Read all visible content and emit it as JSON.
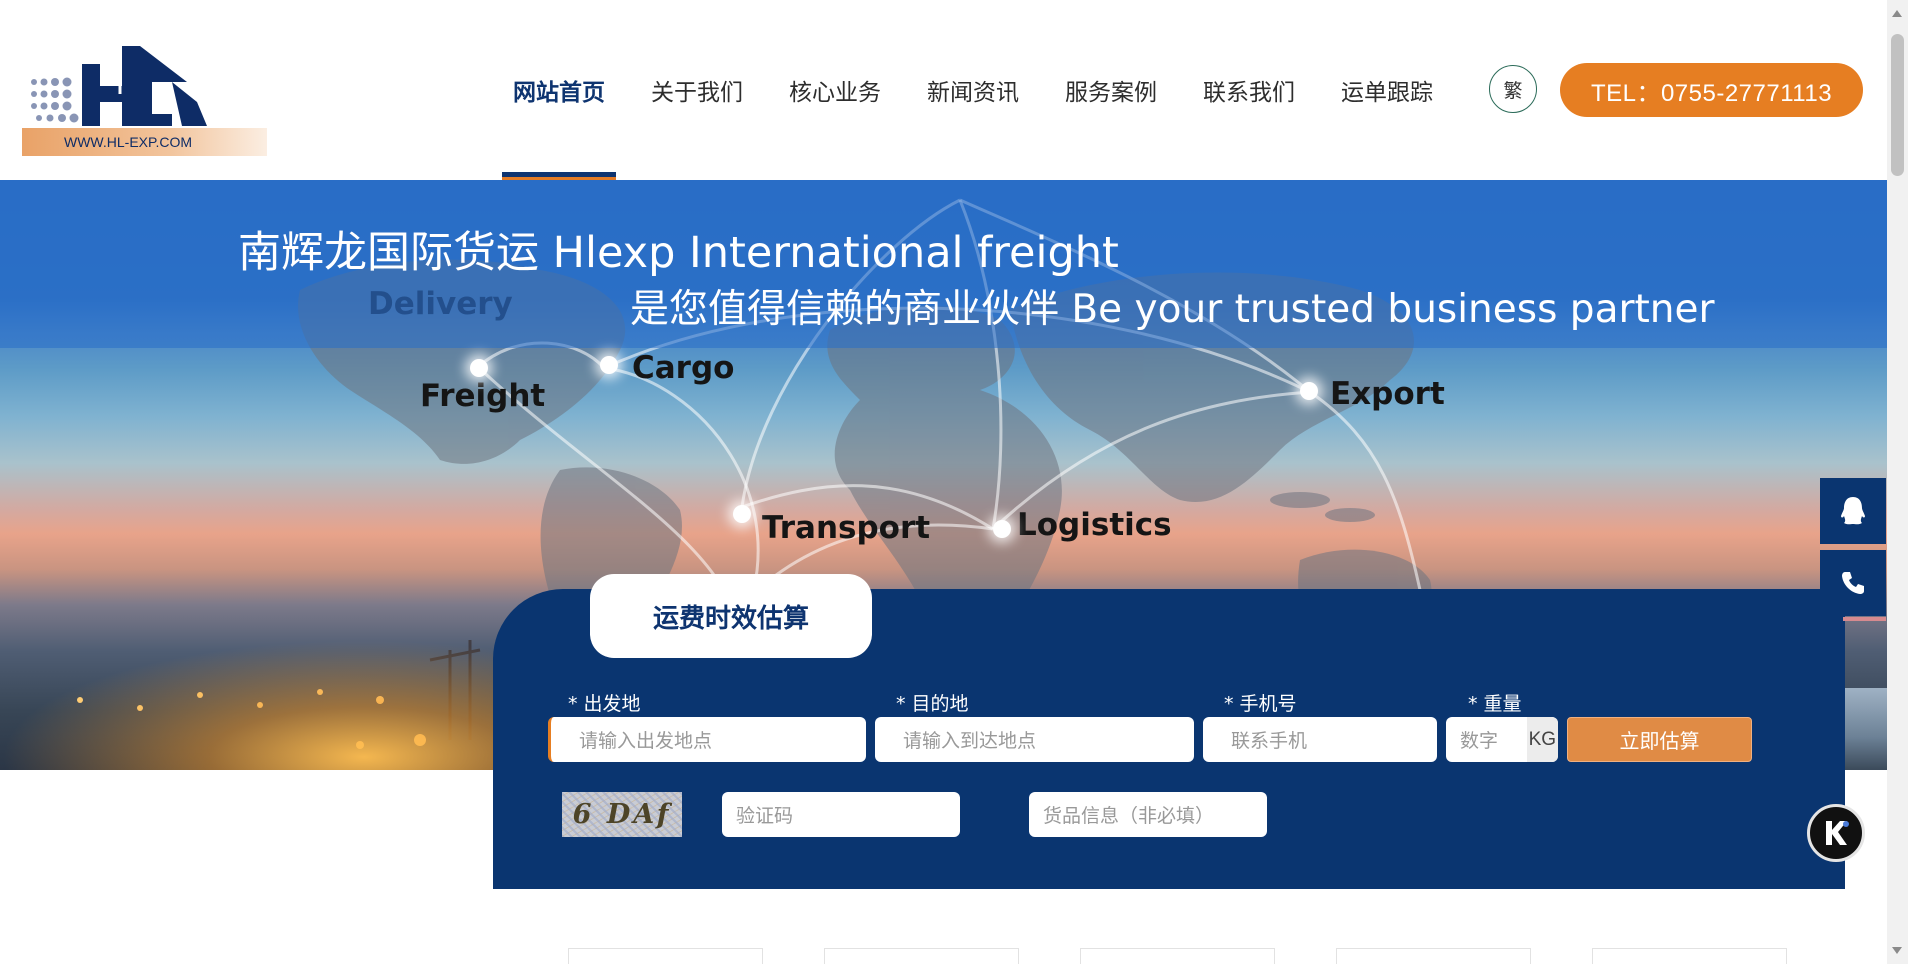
{
  "logo": {
    "text": "HL",
    "url": "WWW.HL-EXP.COM"
  },
  "nav": {
    "items": [
      {
        "label": "网站首页",
        "active": true
      },
      {
        "label": "关于我们"
      },
      {
        "label": "核心业务"
      },
      {
        "label": "新闻资讯"
      },
      {
        "label": "服务案例"
      },
      {
        "label": "联系我们"
      },
      {
        "label": "运单跟踪"
      }
    ],
    "lang_label": "繁",
    "tel_label": "TEL：0755-27771113"
  },
  "banner": {
    "title": "南辉龙国际货运 Hlexp International freight",
    "subtitle": "是您值得信赖的商业伙伴 Be your trusted business partner",
    "labels": {
      "delivery": "Delivery",
      "cargo": "Cargo",
      "freight": "Freight",
      "export": "Export",
      "transport": "Transport",
      "logistics": "Logistics"
    }
  },
  "estimator": {
    "tab_label": "运费时效估算",
    "fields": {
      "origin": {
        "label": "* 出发地",
        "placeholder": "请输入出发地点"
      },
      "destination": {
        "label": "* 目的地",
        "placeholder": "请输入到达地点"
      },
      "phone": {
        "label": "* 手机号",
        "placeholder": "联系手机"
      },
      "weight": {
        "label": "* 重量",
        "placeholder": "数字",
        "unit": "KG"
      }
    },
    "submit_label": "立即估算",
    "captcha_text": "6 DAf",
    "captcha_placeholder": "验证码",
    "goods_placeholder": "货品信息（非必填）"
  },
  "floating": {
    "qq_icon": "qq-icon",
    "phone_icon": "phone-icon",
    "chat_icon": "k-chat-icon"
  },
  "colors": {
    "navy": "#0a3570",
    "orange": "#e67e22",
    "banner_blue": "#2a6dc3"
  }
}
